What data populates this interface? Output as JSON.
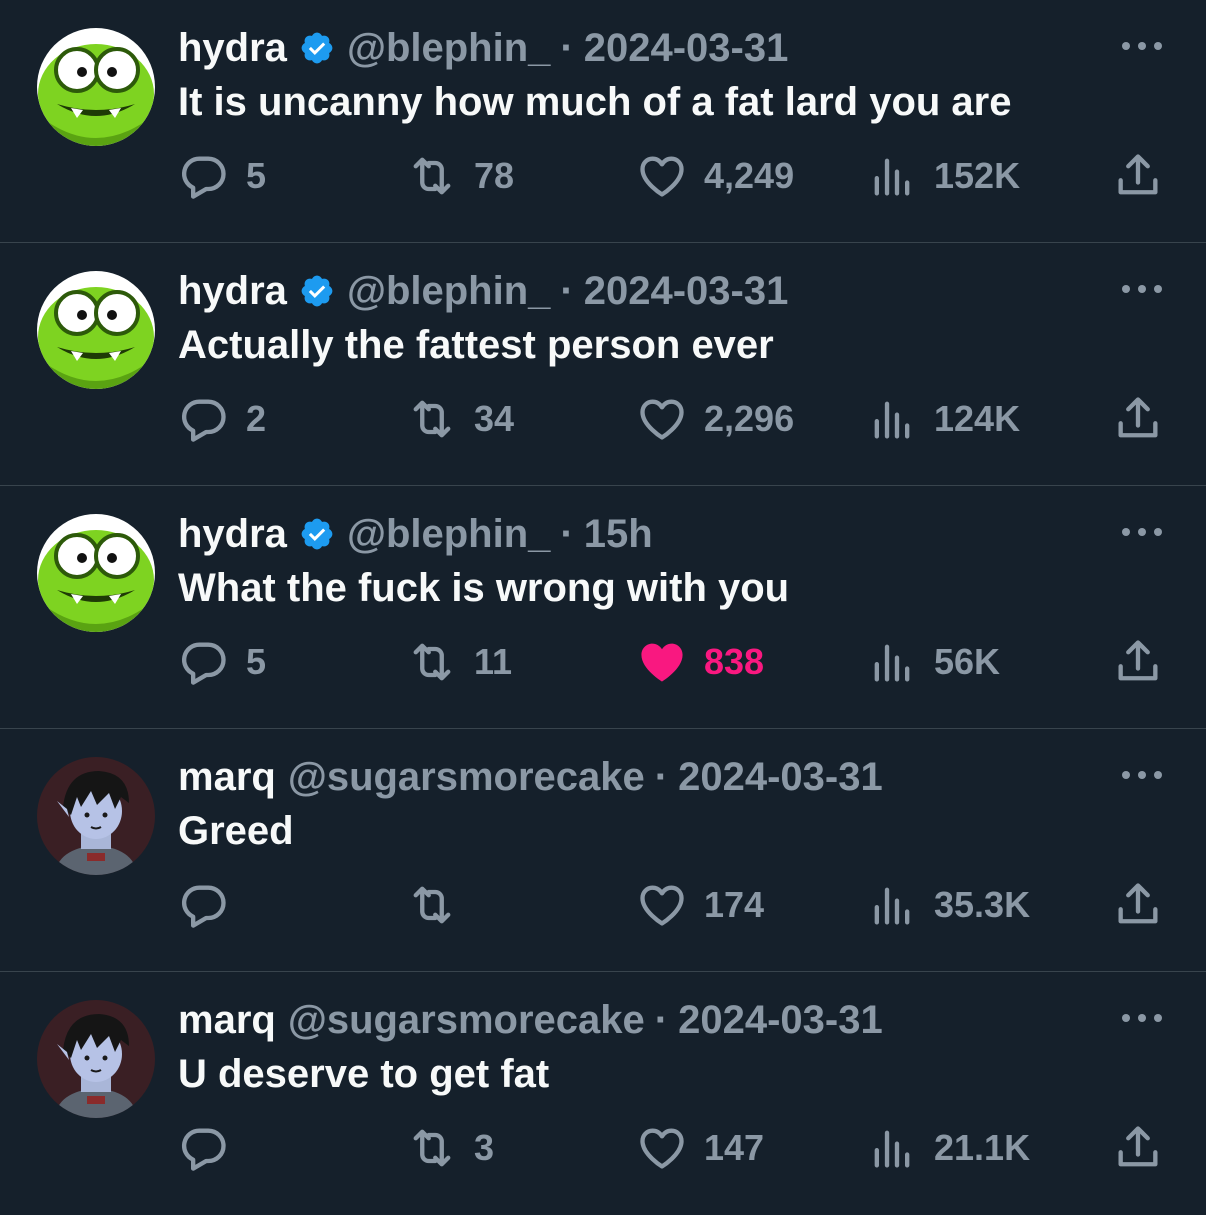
{
  "colors": {
    "background": "#15202b",
    "text": "#f7f9f9",
    "muted": "#8b98a5",
    "verified": "#1d9bf0",
    "like_active": "#f91880",
    "divider": "#38444d"
  },
  "tweets": [
    {
      "name": "hydra",
      "verified": true,
      "handle": "@blephin_",
      "sep": "·",
      "time": "2024-03-31",
      "text": "It is uncanny how much of a fat lard you are",
      "replies": "5",
      "retweets": "78",
      "likes": "4,249",
      "views": "152K",
      "liked": false,
      "avatar": "green-monster-avatar"
    },
    {
      "name": "hydra",
      "verified": true,
      "handle": "@blephin_",
      "sep": "·",
      "time": "2024-03-31",
      "text": "Actually the fattest person ever",
      "replies": "2",
      "retweets": "34",
      "likes": "2,296",
      "views": "124K",
      "liked": false,
      "avatar": "green-monster-avatar"
    },
    {
      "name": "hydra",
      "verified": true,
      "handle": "@blephin_",
      "sep": "·",
      "time": "15h",
      "text": "What the fuck is wrong with you",
      "replies": "5",
      "retweets": "11",
      "likes": "838",
      "views": "56K",
      "liked": true,
      "avatar": "green-monster-avatar"
    },
    {
      "name": "marq",
      "verified": false,
      "handle": "@sugarsmorecake",
      "sep": "·",
      "time": "2024-03-31",
      "text": "Greed",
      "replies": "",
      "retweets": "",
      "likes": "174",
      "views": "35.3K",
      "liked": false,
      "avatar": "vampire-cartoon-avatar"
    },
    {
      "name": "marq",
      "verified": false,
      "handle": "@sugarsmorecake",
      "sep": "·",
      "time": "2024-03-31",
      "text": "U deserve to get fat",
      "replies": "",
      "retweets": "3",
      "likes": "147",
      "views": "21.1K",
      "liked": false,
      "avatar": "vampire-cartoon-avatar"
    }
  ]
}
